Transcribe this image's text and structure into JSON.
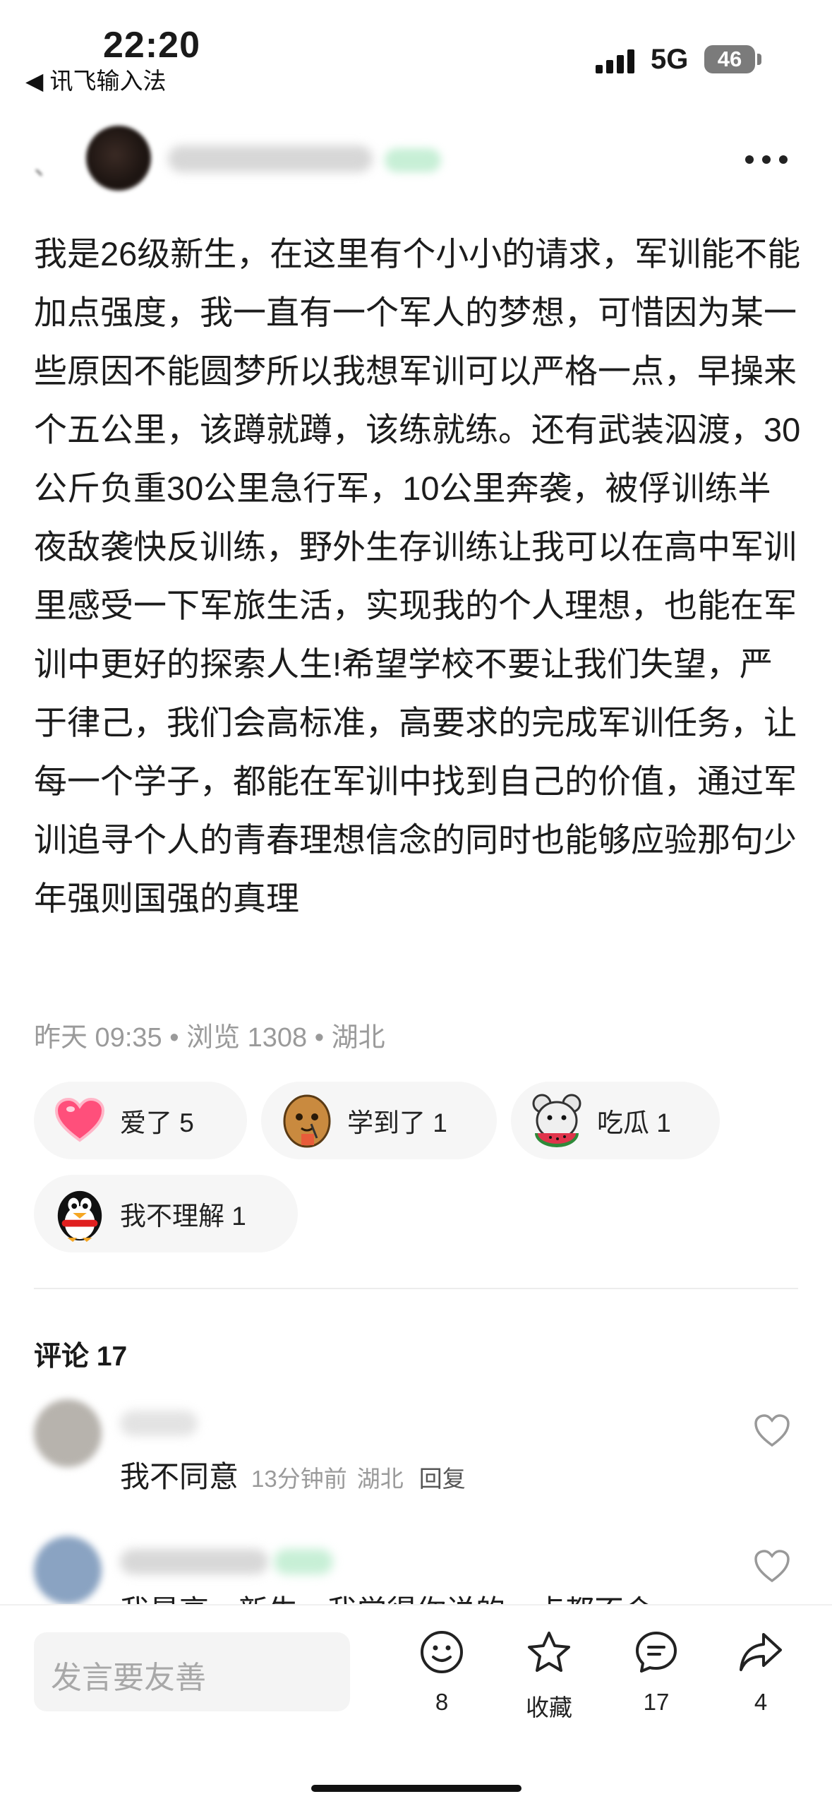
{
  "status_bar": {
    "time": "22:20",
    "back_app": "◀ 讯飞输入法",
    "network": "5G",
    "battery": "46"
  },
  "author": {
    "blurred_prefix": "、",
    "more_icon": "more-horizontal-icon"
  },
  "post": {
    "body": "我是26级新生，在这里有个小小的请求，军训能不能加点强度，我一直有一个军人的梦想，可惜因为某一些原因不能圆梦所以我想军训可以严格一点，早操来个五公里，该蹲就蹲，该练就练。还有武装泅渡，30公斤负重30公里急行军，10公里奔袭，被俘训练半夜敌袭快反训练，野外生存训练让我可以在高中军训里感受一下军旅生活，实现我的个人理想，也能在军训中更好的探索人生!希望学校不要让我们失望，严于律己，我们会高标准，高要求的完成军训任务，让每一个学子，都能在军训中找到自己的价值，通过军训追寻个人的青春理想信念的同时也能够应验那句少年强则国强的真理",
    "meta": "昨天 09:35 • 浏览 1308 • 湖北"
  },
  "reactions": [
    {
      "icon": "heart-icon",
      "label": "爱了 5"
    },
    {
      "icon": "potato-sticker-icon",
      "label": "学到了 1"
    },
    {
      "icon": "mouse-watermelon-sticker-icon",
      "label": "吃瓜 1"
    },
    {
      "icon": "penguin-sticker-icon",
      "label": "我不理解 1"
    }
  ],
  "comments_section": {
    "title": "评论 17",
    "comments": [
      {
        "text": "我不同意",
        "time": "13分钟前",
        "location": "湖北",
        "reply": "回复"
      },
      {
        "text": "我是高一新生，我觉得你说的一点都不会"
      }
    ]
  },
  "bottom_bar": {
    "input_placeholder": "发言要友善",
    "emoji_count": "8",
    "favorite_label": "收藏",
    "comment_count": "17",
    "share_count": "4"
  }
}
